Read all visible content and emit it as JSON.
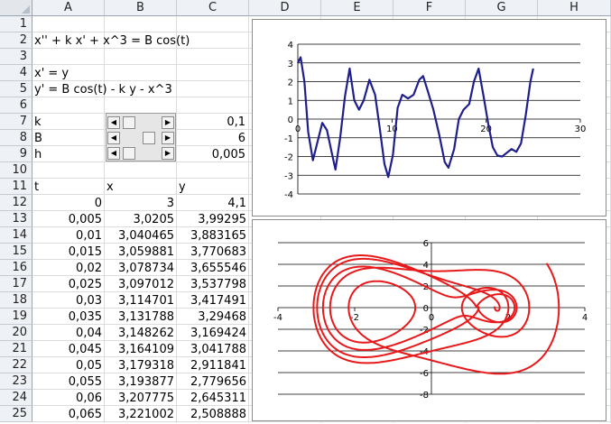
{
  "columns": [
    "A",
    "B",
    "C",
    "D",
    "E",
    "F",
    "G",
    "H"
  ],
  "rows": [
    "1",
    "2",
    "3",
    "4",
    "5",
    "6",
    "7",
    "8",
    "9",
    "10",
    "11",
    "12",
    "13",
    "14",
    "15",
    "16",
    "17",
    "18",
    "19",
    "20",
    "21",
    "22",
    "23",
    "24",
    "25"
  ],
  "equations": {
    "eq1": "x'' + k x' + x^3 = B cos(t)",
    "eq2": "x' = y",
    "eq3": "y' = B cos(t) - k y - x^3"
  },
  "params": [
    {
      "label": "k",
      "value": "0,1"
    },
    {
      "label": "B",
      "value": "6"
    },
    {
      "label": "h",
      "value": "0,005"
    }
  ],
  "table": {
    "headers": [
      "t",
      "x",
      "y"
    ],
    "rows": [
      [
        "0",
        "3",
        "4,1"
      ],
      [
        "0,005",
        "3,0205",
        "3,99295"
      ],
      [
        "0,01",
        "3,040465",
        "3,883165"
      ],
      [
        "0,015",
        "3,059881",
        "3,770683"
      ],
      [
        "0,02",
        "3,078734",
        "3,655546"
      ],
      [
        "0,025",
        "3,097012",
        "3,537798"
      ],
      [
        "0,03",
        "3,114701",
        "3,417491"
      ],
      [
        "0,035",
        "3,131788",
        "3,29468"
      ],
      [
        "0,04",
        "3,148262",
        "3,169424"
      ],
      [
        "0,045",
        "3,164109",
        "3,041788"
      ],
      [
        "0,05",
        "3,179318",
        "2,911841"
      ],
      [
        "0,055",
        "3,193877",
        "2,779656"
      ],
      [
        "0,06",
        "3,207775",
        "2,645311"
      ],
      [
        "0,065",
        "3,221002",
        "2,508888"
      ]
    ]
  },
  "chart_data": [
    {
      "type": "line",
      "color": "#1f1f8c",
      "xlim": [
        0,
        30
      ],
      "ylim": [
        -4,
        4
      ],
      "x_ticks": [
        "0",
        "10",
        "20",
        "30"
      ],
      "y_ticks": [
        "4",
        "3",
        "2",
        "1",
        "0",
        "-1",
        "-2",
        "-3",
        "-4"
      ],
      "points": [
        [
          0,
          3
        ],
        [
          0.3,
          3.3
        ],
        [
          0.7,
          2.0
        ],
        [
          1.1,
          -0.7
        ],
        [
          1.6,
          -2.2
        ],
        [
          2.1,
          -1.2
        ],
        [
          2.6,
          -0.2
        ],
        [
          3.1,
          -0.6
        ],
        [
          3.6,
          -1.8
        ],
        [
          4.0,
          -2.7
        ],
        [
          4.5,
          -1.0
        ],
        [
          5.0,
          1.2
        ],
        [
          5.5,
          2.7
        ],
        [
          6.0,
          1.0
        ],
        [
          6.5,
          0.5
        ],
        [
          7.0,
          1.0
        ],
        [
          7.6,
          2.1
        ],
        [
          8.2,
          1.3
        ],
        [
          8.7,
          -0.5
        ],
        [
          9.2,
          -2.4
        ],
        [
          9.6,
          -3.1
        ],
        [
          10.1,
          -1.9
        ],
        [
          10.6,
          0.6
        ],
        [
          11.1,
          1.3
        ],
        [
          11.7,
          1.1
        ],
        [
          12.3,
          1.3
        ],
        [
          12.9,
          2.1
        ],
        [
          13.3,
          2.3
        ],
        [
          13.8,
          1.5
        ],
        [
          14.4,
          0.5
        ],
        [
          15.0,
          -0.8
        ],
        [
          15.6,
          -2.3
        ],
        [
          16.0,
          -2.6
        ],
        [
          16.6,
          -1.6
        ],
        [
          17.1,
          0.0
        ],
        [
          17.6,
          0.5
        ],
        [
          18.2,
          0.8
        ],
        [
          18.7,
          2.0
        ],
        [
          19.2,
          2.7
        ],
        [
          19.7,
          1.3
        ],
        [
          20.2,
          -0.2
        ],
        [
          20.7,
          -1.5
        ],
        [
          21.2,
          -1.95
        ],
        [
          21.7,
          -2.0
        ],
        [
          22.2,
          -1.8
        ],
        [
          22.7,
          -1.6
        ],
        [
          23.2,
          -1.75
        ],
        [
          23.7,
          -1.3
        ],
        [
          24.2,
          0.2
        ],
        [
          24.7,
          2.0
        ],
        [
          25.0,
          2.7
        ]
      ]
    },
    {
      "type": "line",
      "color": "#e8191b",
      "xlim": [
        -4,
        4
      ],
      "ylim": [
        -8,
        6
      ],
      "x_ticks": [
        "-4",
        "-2",
        "0",
        "2",
        "4"
      ],
      "y_ticks": [
        "6",
        "4",
        "2",
        "0",
        "-2",
        "-4",
        "-6",
        "-8"
      ]
    }
  ]
}
